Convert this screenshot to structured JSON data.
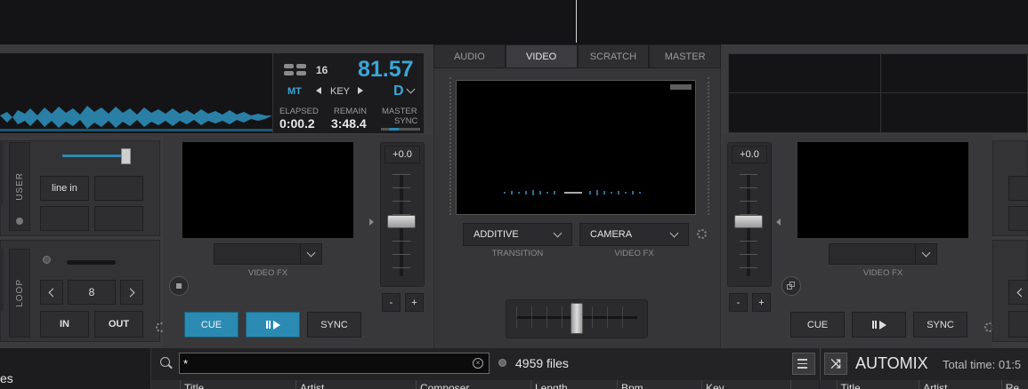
{
  "deck_left": {
    "bpm_label": "16",
    "bpm": "81.57",
    "mt_label": "MT",
    "key_label": "KEY",
    "key_value": "D",
    "elapsed_label": "ELAPSED",
    "elapsed_value": "0:00.2",
    "remain_label": "REMAIN",
    "remain_value": "3:48.4",
    "master_label": "MASTER",
    "sync_label": "SYNC",
    "user_label": "USER",
    "line_in_label": "line in",
    "loop_label": "LOOP",
    "loop_size": "8",
    "in_label": "IN",
    "out_label": "OUT",
    "pitch_value": "+0.0",
    "video_fx_label": "VIDEO FX",
    "cue_label": "CUE",
    "sync_button_label": "SYNC",
    "minus_label": "-",
    "plus_label": "+"
  },
  "center": {
    "tabs": [
      "AUDIO",
      "VIDEO",
      "SCRATCH",
      "MASTER"
    ],
    "active_tab": "VIDEO",
    "transition_value": "ADDITIVE",
    "transition_label": "TRANSITION",
    "video_fx_value": "CAMERA",
    "video_fx_label": "VIDEO FX"
  },
  "deck_right": {
    "pitch_value": "+0.0",
    "video_fx_label": "VIDEO FX",
    "cue_label": "CUE",
    "sync_button_label": "SYNC",
    "minus_label": "-",
    "plus_label": "+"
  },
  "browser": {
    "left_fragment": "es",
    "search_value": "*",
    "files_count": "4959 files",
    "columns_left": [
      "Title",
      "Artist",
      "Composer",
      "Length",
      "Bpm",
      "Key"
    ],
    "automix_label": "AUTOMIX",
    "total_time": "Total time: 01:5",
    "columns_right": [
      "Title",
      "Artist",
      "Re"
    ]
  },
  "colors": {
    "accent": "#2b8ab2",
    "bpm_text": "#3aa6d6",
    "panel": "#333336",
    "background": "#3b3b3e"
  }
}
